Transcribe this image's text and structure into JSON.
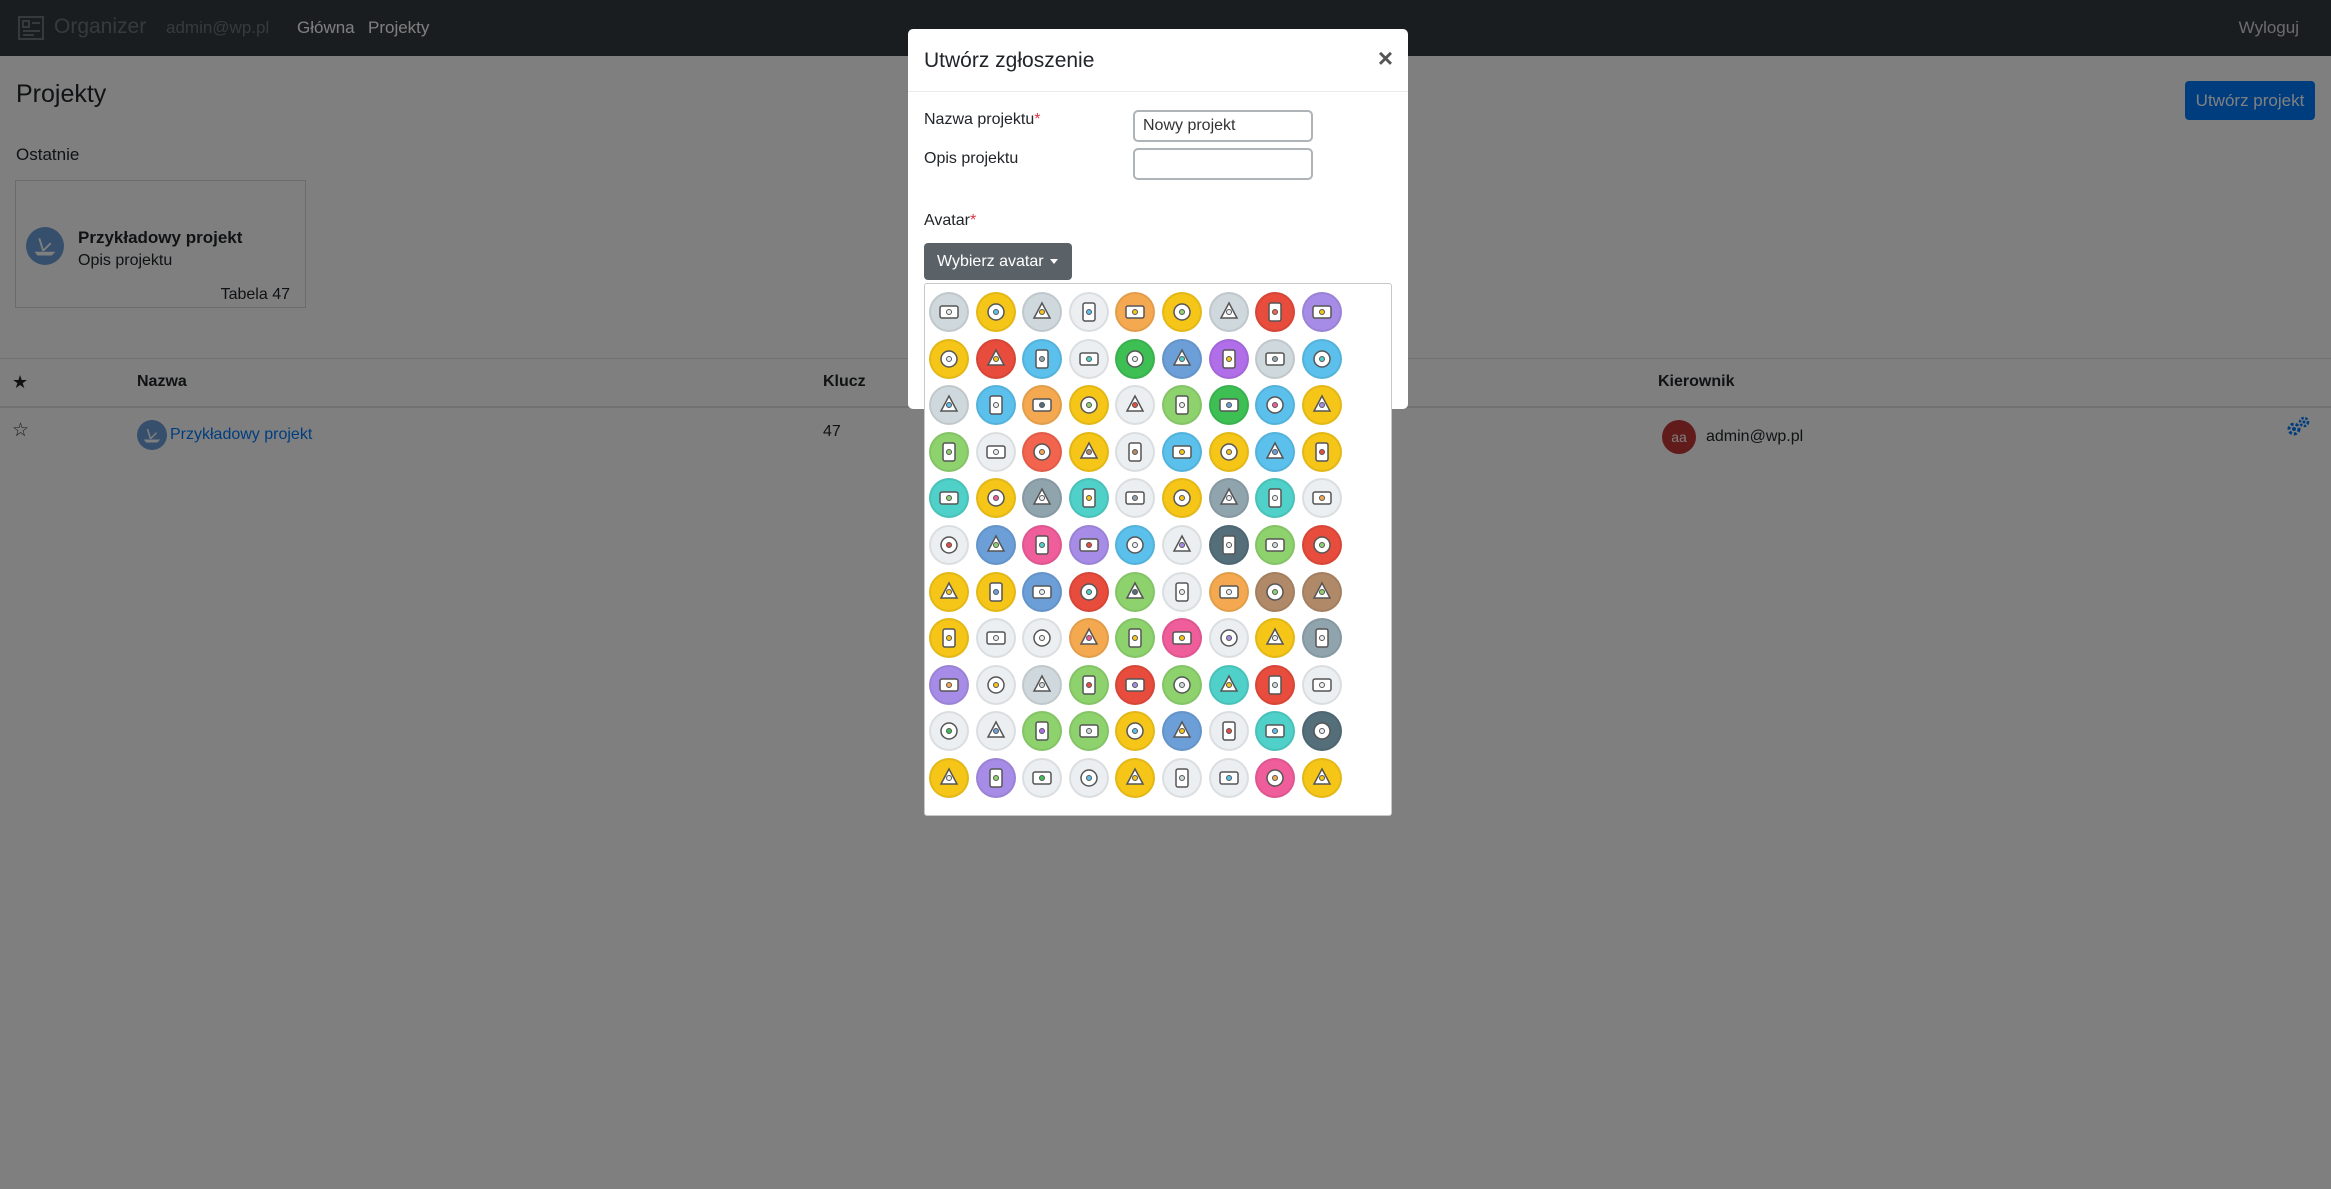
{
  "navbar": {
    "brand": "Organizer",
    "user_email": "admin@wp.pl",
    "links": [
      "Główna",
      "Projekty"
    ],
    "logout": "Wyloguj"
  },
  "page": {
    "title": "Projekty",
    "create_button": "Utwórz projekt"
  },
  "recent": {
    "label": "Ostatnie",
    "card": {
      "name": "Przykładowy projekt",
      "description": "Opis projektu",
      "subtitle": "Tabela 47"
    }
  },
  "table": {
    "headers": {
      "name": "Nazwa",
      "key": "Klucz",
      "manager": "Kierownik"
    },
    "rows": [
      {
        "name": "Przykładowy projekt",
        "key": "47",
        "manager_initials": "aa",
        "manager_email": "admin@wp.pl"
      }
    ]
  },
  "modal": {
    "title": "Utwórz zgłoszenie",
    "close": "×",
    "name_label": "Nazwa projektu",
    "name_value": "Nowy projekt",
    "description_label": "Opis projektu",
    "description_value": "",
    "avatar_label": "Avatar",
    "required_mark": "*",
    "choose_avatar_button": "Wybierz avatar"
  },
  "avatar_palette": {
    "icons": [
      [
        "truck",
        "airplane",
        "ship",
        "car",
        "bulldozer",
        "lemon",
        "carrot",
        "pear",
        "pen-nib"
      ],
      [
        "spray-bottle",
        "paint-brush",
        "hammer",
        "window-cursor",
        "ping-pong",
        "boat-docked",
        "grapes",
        "download",
        "door"
      ],
      [
        "vinyl-disc",
        "atom",
        "light-bulb",
        "speedometer",
        "baby-mobile",
        "smiley-face",
        "robot",
        "umbrella",
        "shield"
      ],
      [
        "keyhole",
        "tree",
        "sun",
        "documents",
        "printer",
        "eye",
        "contrast",
        "gauge",
        "cloud"
      ],
      [
        "ruler",
        "bomb",
        "medal",
        "ship-wheel",
        "joystick",
        "map",
        "chip",
        "exit-sign",
        "safe"
      ],
      [
        "id-card",
        "user",
        "user-female",
        "astronaut",
        "pointing-hand",
        "diamond",
        "snowflake",
        "flower",
        "basket"
      ],
      [
        "credit-card",
        "wallet",
        "scales",
        "money",
        "line-chart",
        "plate",
        "cookie",
        "pills",
        "meat-leg"
      ],
      [
        "croissant",
        "donut",
        "rocket",
        "cracker",
        "coffee-cup",
        "wine-glass",
        "bottle",
        "phone-tablet",
        "telephone"
      ],
      [
        "record",
        "signal-bars",
        "server",
        "phone-call",
        "radio",
        "guitar",
        "keyboard",
        "camera-tripod",
        "spiral"
      ],
      [
        "vector-shape",
        "bezier-curve",
        "shopping-bag",
        "briefcase",
        "presentation",
        "home",
        "share",
        "stopwatch",
        "moon"
      ],
      [
        "windmill",
        "building",
        "skyscraper",
        "factory",
        "gas-pump",
        "virus",
        "heart",
        "tooth",
        "pill"
      ]
    ],
    "colors": [
      [
        "#cfd8dc",
        "#f5c518",
        "#cfd8dc",
        "#eceff1",
        "#f4a950",
        "#f5c518",
        "#cfd8dc",
        "#e74c3c",
        "#a68ce6"
      ],
      [
        "#f5c518",
        "#e74c3c",
        "#5bc0eb",
        "#eceff1",
        "#3dbf54",
        "#6c9fd8",
        "#b06ee8",
        "#cfd8dc",
        "#5bc0eb"
      ],
      [
        "#cfd8dc",
        "#5bc0eb",
        "#f4a950",
        "#f5c518",
        "#eceff1",
        "#8ed26e",
        "#3dbf54",
        "#5bc0eb",
        "#f5c518"
      ],
      [
        "#8ed26e",
        "#eceff1",
        "#f2644e",
        "#f5c518",
        "#eceff1",
        "#5bc0eb",
        "#f5c518",
        "#5bc0eb",
        "#f5c518"
      ],
      [
        "#4fd0c8",
        "#f5c518",
        "#90a4ae",
        "#4fd0c8",
        "#eceff1",
        "#f5c518",
        "#90a4ae",
        "#4fd0c8",
        "#eceff1"
      ],
      [
        "#eceff1",
        "#6c9fd8",
        "#ef5d9a",
        "#a68ce6",
        "#5bc0eb",
        "#eceff1",
        "#546e7a",
        "#8ed26e",
        "#e74c3c"
      ],
      [
        "#f5c518",
        "#f5c518",
        "#6c9fd8",
        "#e74c3c",
        "#8ed26e",
        "#eceff1",
        "#f4a950",
        "#b08968",
        "#b08968"
      ],
      [
        "#f5c518",
        "#eceff1",
        "#eceff1",
        "#f4a950",
        "#8ed26e",
        "#ef5d9a",
        "#eceff1",
        "#f5c518",
        "#90a4ae"
      ],
      [
        "#a68ce6",
        "#eceff1",
        "#cfd8dc",
        "#8ed26e",
        "#e74c3c",
        "#8ed26e",
        "#4fd0c8",
        "#e74c3c",
        "#eceff1"
      ],
      [
        "#eceff1",
        "#eceff1",
        "#8ed26e",
        "#8ed26e",
        "#f5c518",
        "#6c9fd8",
        "#eceff1",
        "#4fd0c8",
        "#546e7a"
      ],
      [
        "#f5c518",
        "#a68ce6",
        "#eceff1",
        "#eceff1",
        "#f5c518",
        "#eceff1",
        "#eceff1",
        "#ef5d9a",
        "#f5c518"
      ]
    ]
  }
}
